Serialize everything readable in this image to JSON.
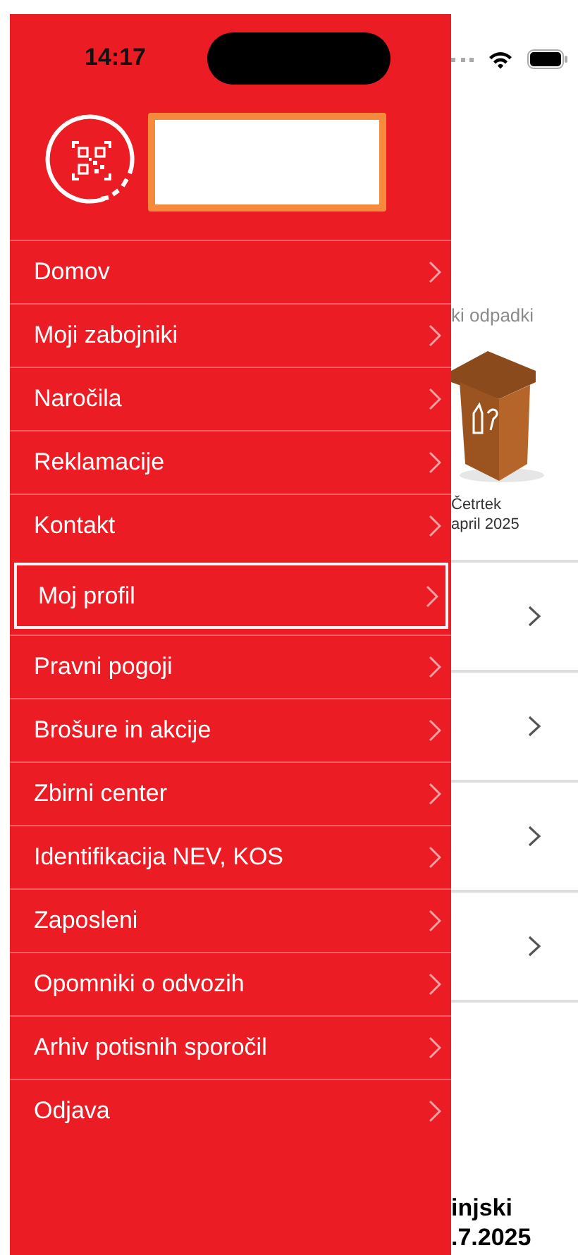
{
  "status_bar": {
    "time": "14:17"
  },
  "background": {
    "waste_title": "ki odpadki",
    "day": "Četrtek",
    "date": "april 2025",
    "card_title": "injski",
    "card_date": ".7.2025"
  },
  "menu": {
    "items": [
      {
        "label": "Domov",
        "selected": false
      },
      {
        "label": "Moji zabojniki",
        "selected": false
      },
      {
        "label": "Naročila",
        "selected": false
      },
      {
        "label": "Reklamacije",
        "selected": false
      },
      {
        "label": "Kontakt",
        "selected": false
      },
      {
        "label": "Moj profil",
        "selected": true
      },
      {
        "label": "Pravni pogoji",
        "selected": false
      },
      {
        "label": "Brošure in akcije",
        "selected": false
      },
      {
        "label": "Zbirni center",
        "selected": false
      },
      {
        "label": "Identifikacija NEV, KOS",
        "selected": false
      },
      {
        "label": "Zaposleni",
        "selected": false
      },
      {
        "label": "Opomniki o odvozih",
        "selected": false
      },
      {
        "label": "Arhiv potisnih sporočil",
        "selected": false
      },
      {
        "label": "Odjava",
        "selected": false
      }
    ]
  }
}
